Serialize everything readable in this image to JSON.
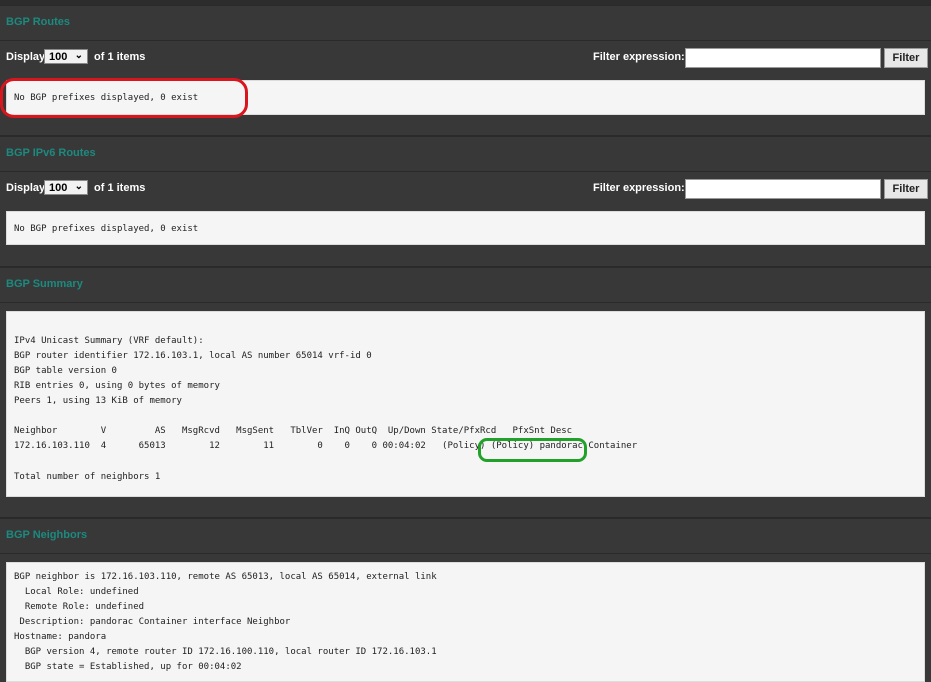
{
  "sections": {
    "routes": {
      "title": "BGP Routes",
      "display_label": "Display",
      "display_value": "100",
      "items_label": "of 1 items",
      "filter_label": "Filter expression:",
      "filter_value": "",
      "filter_button": "Filter",
      "message": "No BGP prefixes displayed, 0 exist"
    },
    "ipv6_routes": {
      "title": "BGP IPv6 Routes",
      "display_label": "Display",
      "display_value": "100",
      "items_label": "of 1 items",
      "filter_label": "Filter expression:",
      "filter_value": "",
      "filter_button": "Filter",
      "message": "No BGP prefixes displayed, 0 exist"
    },
    "summary": {
      "title": "BGP Summary",
      "lines": [
        "IPv4 Unicast Summary (VRF default):",
        "BGP router identifier 172.16.103.1, local AS number 65014 vrf-id 0",
        "BGP table version 0",
        "RIB entries 0, using 0 bytes of memory",
        "Peers 1, using 13 KiB of memory",
        "",
        "Neighbor        V         AS   MsgRcvd   MsgSent   TblVer  InQ OutQ  Up/Down State/PfxRcd   PfxSnt Desc",
        "172.16.103.110  4      65013        12        11        0    0    0 00:04:02   (Policy) (Policy) pandorac Container",
        "",
        "Total number of neighbors 1"
      ]
    },
    "neighbors": {
      "title": "BGP Neighbors",
      "lines": [
        "BGP neighbor is 172.16.103.110, remote AS 65013, local AS 65014, external link",
        "  Local Role: undefined",
        "  Remote Role: undefined",
        " Description: pandorac Container interface Neighbor",
        "Hostname: pandora",
        "  BGP version 4, remote router ID 172.16.100.110, local router ID 172.16.103.1",
        "  BGP state = Established, up for 00:04:02"
      ]
    }
  },
  "colors": {
    "section_title": "#1c8a7f",
    "background": "#383838",
    "panel": "#f5f5f5",
    "highlight_red": "#d9151d",
    "highlight_green": "#22a12a"
  }
}
